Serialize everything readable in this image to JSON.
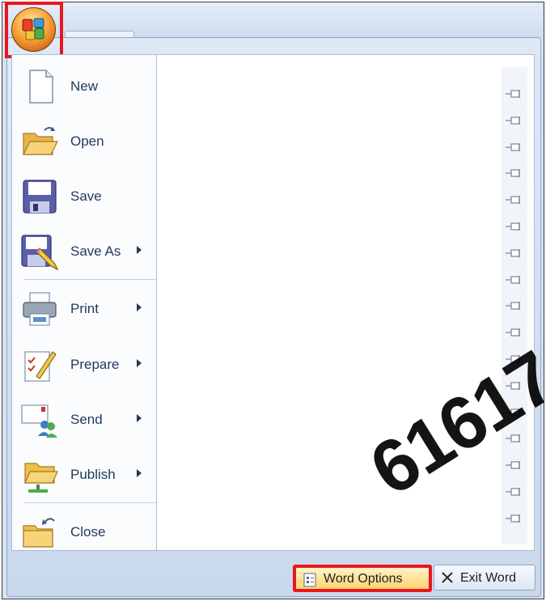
{
  "menu": {
    "items": [
      {
        "label": "New",
        "has_submenu": false,
        "icon": "new-document-icon"
      },
      {
        "label": "Open",
        "has_submenu": false,
        "icon": "open-folder-icon"
      },
      {
        "label": "Save",
        "has_submenu": false,
        "icon": "floppy-disk-icon"
      },
      {
        "label": "Save As",
        "has_submenu": true,
        "icon": "save-as-icon"
      },
      {
        "label": "Print",
        "has_submenu": true,
        "icon": "printer-icon"
      },
      {
        "label": "Prepare",
        "has_submenu": true,
        "icon": "prepare-icon"
      },
      {
        "label": "Send",
        "has_submenu": true,
        "icon": "send-icon"
      },
      {
        "label": "Publish",
        "has_submenu": true,
        "icon": "publish-icon"
      },
      {
        "label": "Close",
        "has_submenu": false,
        "icon": "close-folder-icon"
      }
    ]
  },
  "footer": {
    "options_label": "Word Options",
    "exit_label": "Exit Word"
  },
  "watermark": "61617",
  "colors": {
    "highlight": "#e8161f",
    "menu_text": "#1e395b"
  }
}
